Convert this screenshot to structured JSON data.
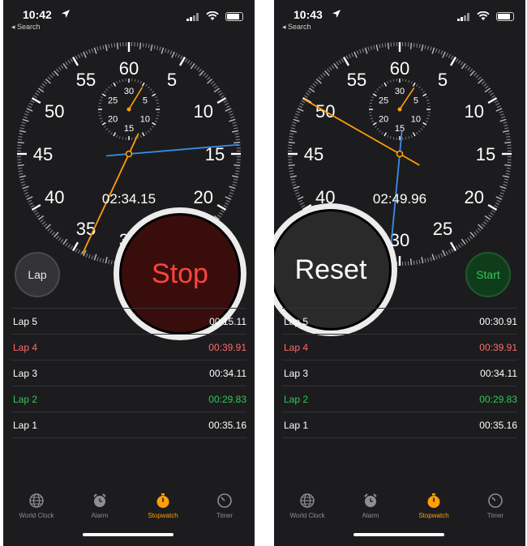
{
  "colors": {
    "background": "#1c1c1e",
    "accent": "#ff9f0a",
    "blue_hand": "#3b8beb",
    "stop_red": "#ff453a",
    "start_green": "#34c759",
    "lap_best_green": "#34c759",
    "lap_worst_red": "#ff6b6b"
  },
  "dial_labels": [
    "60",
    "5",
    "10",
    "15",
    "20",
    "25",
    "30",
    "35",
    "40",
    "45",
    "50",
    "55"
  ],
  "subdial_labels": [
    "30",
    "5",
    "10",
    "15",
    "20",
    "25"
  ],
  "screens": [
    {
      "status": {
        "time": "10:42",
        "back_label": "◂ Search"
      },
      "readout": "02:34.15",
      "buttons": {
        "left_label": "Lap",
        "big_label": "Stop"
      },
      "hands": {
        "main_seconds": 34.15,
        "lap_seconds": 14.2,
        "subdial_minutes": 2.6
      },
      "laps": [
        {
          "name": "Lap 5",
          "time": "00:15.11",
          "style": "normal"
        },
        {
          "name": "Lap 4",
          "time": "00:39.91",
          "style": "worst"
        },
        {
          "name": "Lap 3",
          "time": "00:34.11",
          "style": "normal"
        },
        {
          "name": "Lap 2",
          "time": "00:29.83",
          "style": "best"
        },
        {
          "name": "Lap 1",
          "time": "00:35.16",
          "style": "normal"
        }
      ]
    },
    {
      "status": {
        "time": "10:43",
        "back_label": "◂ Search"
      },
      "readout": "02:49.96",
      "buttons": {
        "big_label": "Reset",
        "right_label": "Start"
      },
      "hands": {
        "main_seconds": 49.96,
        "lap_seconds": 30.9,
        "subdial_minutes": 2.8
      },
      "laps": [
        {
          "name": "Lap 5",
          "time": "00:30.91",
          "style": "normal"
        },
        {
          "name": "Lap 4",
          "time": "00:39.91",
          "style": "worst"
        },
        {
          "name": "Lap 3",
          "time": "00:34.11",
          "style": "normal"
        },
        {
          "name": "Lap 2",
          "time": "00:29.83",
          "style": "best"
        },
        {
          "name": "Lap 1",
          "time": "00:35.16",
          "style": "normal"
        }
      ]
    }
  ],
  "tabs": [
    {
      "label": "World Clock",
      "icon": "globe-icon"
    },
    {
      "label": "Alarm",
      "icon": "alarm-clock-icon"
    },
    {
      "label": "Stopwatch",
      "icon": "stopwatch-icon",
      "active": true
    },
    {
      "label": "Timer",
      "icon": "timer-icon"
    }
  ]
}
